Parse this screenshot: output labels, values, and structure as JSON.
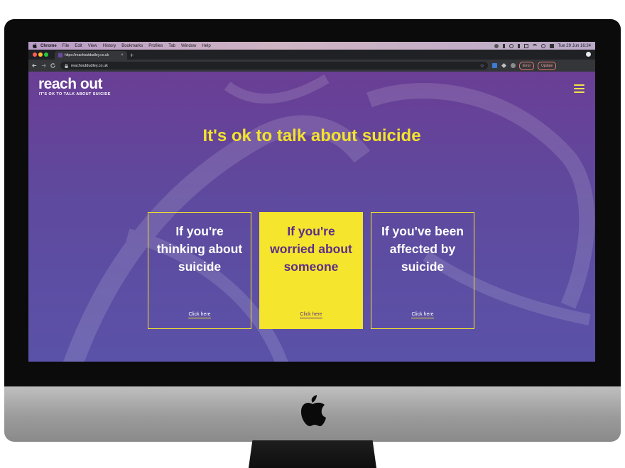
{
  "menubar": {
    "app_name": "Chrome",
    "items": [
      "File",
      "Edit",
      "View",
      "History",
      "Bookmarks",
      "Profiles",
      "Tab",
      "Window",
      "Help"
    ],
    "datetime": "Tue 29 Jun  16:24"
  },
  "browser": {
    "tab_favicon": "RO",
    "tab_title": "https://reachoutdudley.co.uk",
    "tab_close": "×",
    "new_tab": "+",
    "url": "reachoutdudley.co.uk",
    "error_label": "Error",
    "update_label": "Update"
  },
  "site": {
    "logo": "reach out",
    "tagline": "IT'S OK TO TALK ABOUT SUICIDE",
    "hero_title": "It's ok to talk about suicide",
    "cards": [
      {
        "title": "If you're thinking about suicide",
        "link": "Click here"
      },
      {
        "title": "If you're worried about someone",
        "link": "Click here"
      },
      {
        "title": "If you've been affected by suicide",
        "link": "Click here"
      }
    ]
  },
  "colors": {
    "accent_yellow": "#f3e32b",
    "brand_purple": "#5b2d8a"
  },
  "icons": [
    "apple-logo-icon",
    "menu-hamburger-icon",
    "lock-icon",
    "star-icon",
    "back-arrow-icon",
    "forward-arrow-icon",
    "reload-icon"
  ]
}
